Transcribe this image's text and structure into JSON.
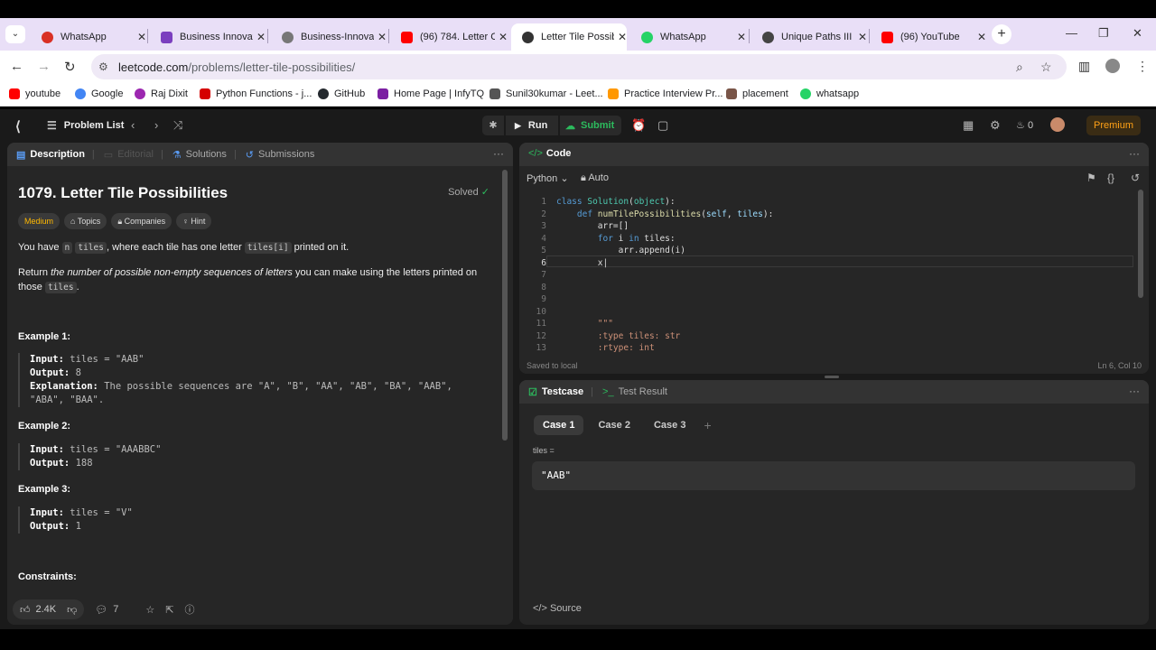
{
  "browser": {
    "tabs": [
      {
        "label": "WhatsApp",
        "icon": "whatsapp-error-icon",
        "color": "#d93025"
      },
      {
        "label": "Business Innovat",
        "icon": "business-icon",
        "color": "#7b3fbf"
      },
      {
        "label": "Business-Innovat",
        "icon": "globe-icon",
        "color": "#666666"
      },
      {
        "label": "(96) 784. Letter C",
        "icon": "youtube-icon",
        "color": "#ff0000"
      },
      {
        "label": "Letter Tile Possib",
        "icon": "leetcode-icon",
        "color": "#333333"
      },
      {
        "label": "WhatsApp",
        "icon": "whatsapp-icon",
        "color": "#25d366"
      },
      {
        "label": "Unique Paths III",
        "icon": "leetcode-icon",
        "color": "#333333"
      },
      {
        "label": "(96) YouTube",
        "icon": "youtube-icon",
        "color": "#ff0000"
      }
    ],
    "url_host": "leetcode.com",
    "url_path": "/problems/letter-tile-possibilities/",
    "bookmarks": [
      {
        "label": "youtube",
        "color": "#ff0000"
      },
      {
        "label": "Google",
        "color": "#4285f4"
      },
      {
        "label": "Raj Dixit",
        "color": "#9c27b0"
      },
      {
        "label": "Python Functions - j...",
        "color": "#d50000"
      },
      {
        "label": "GitHub",
        "color": "#24292e"
      },
      {
        "label": "Home Page | InfyTQ",
        "color": "#7b1fa2"
      },
      {
        "label": "Sunil30kumar - Leet...",
        "color": "#555555"
      },
      {
        "label": "Practice Interview Pr...",
        "color": "#ff9800"
      },
      {
        "label": "placement",
        "color": "#795548"
      },
      {
        "label": "whatsapp",
        "color": "#25d366"
      }
    ]
  },
  "lc": {
    "problem_list": "Problem List",
    "run": "Run",
    "submit": "Submit",
    "streak": "0",
    "premium": "Premium"
  },
  "left": {
    "tabs": {
      "description": "Description",
      "editorial": "Editorial",
      "solutions": "Solutions",
      "submissions": "Submissions"
    },
    "title": "1079. Letter Tile Possibilities",
    "solved": "Solved",
    "chips": {
      "difficulty": "Medium",
      "topics": "Topics",
      "companies": "Companies",
      "hint": "Hint"
    },
    "para1": {
      "a": "You have",
      "n": "n",
      "tiles": "tiles",
      "b": ", where each tile has one letter",
      "code": "tiles[i]",
      "c": "printed on it."
    },
    "para2": {
      "a": "Return",
      "em": "the number of possible non-empty sequences of letters",
      "b": "you can make using the letters printed on those",
      "code": "tiles",
      "c": "."
    },
    "examples": [
      {
        "title": "Example 1:",
        "input_label": "Input:",
        "input": "tiles = \"AAB\"",
        "output_label": "Output:",
        "output": "8",
        "explanation_label": "Explanation:",
        "explanation1": "The possible sequences are \"A\", \"B\", \"AA\", \"AB\", \"BA\", \"AAB\",",
        "explanation2": "\"ABA\", \"BAA\"."
      },
      {
        "title": "Example 2:",
        "input_label": "Input:",
        "input": "tiles = \"AAABBC\"",
        "output_label": "Output:",
        "output": "188"
      },
      {
        "title": "Example 3:",
        "input_label": "Input:",
        "input": "tiles = \"V\"",
        "output_label": "Output:",
        "output": "1"
      }
    ],
    "constraints": "Constraints:",
    "likes": "2.4K",
    "comments": "7"
  },
  "code": {
    "title": "Code",
    "language": "Python",
    "auto": "Auto",
    "line_numbers": [
      "1",
      "2",
      "3",
      "4",
      "5",
      "6",
      "7",
      "8",
      "9",
      "10",
      "11",
      "12",
      "13"
    ],
    "current_line": "6",
    "saved": "Saved to local",
    "position": "Ln 6, Col 10"
  },
  "testcase": {
    "tab_testcase": "Testcase",
    "tab_result": "Test Result",
    "cases": [
      "Case 1",
      "Case 2",
      "Case 3"
    ],
    "param_label": "tiles =",
    "param_value": "\"AAB\"",
    "source": "Source"
  }
}
